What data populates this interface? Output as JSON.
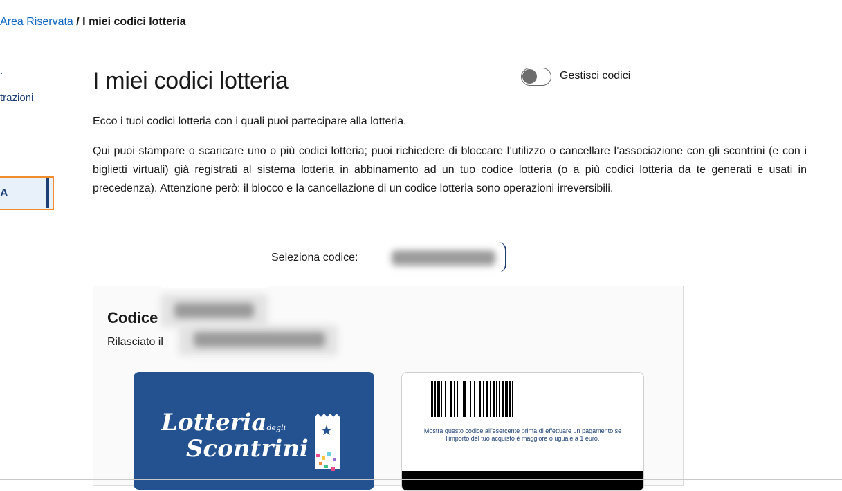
{
  "breadcrumb": {
    "link": "Area Riservata",
    "separator": " / ",
    "current": "I miei codici lotteria"
  },
  "sidebar": {
    "item_partial": "trazioni",
    "active_partial": "A"
  },
  "page": {
    "title": "I miei codici lotteria",
    "toggle_label": "Gestisci codici",
    "toggle_on": false,
    "intro": "Ecco i tuoi codici lotteria con i quali puoi partecipare alla lotteria.",
    "description": "Qui puoi stampare o scaricare uno o più codici lotteria; puoi richiedere di bloccare l’utilizzo o cancellare l’associazione con gli scontrini (e con i biglietti virtuali) già registrati al sistema lotteria in abbinamento ad un tuo codice lotteria (o a più codici lotteria da te generati e usati in precedenza). Attenzione però: il blocco e la cancellazione di un codice lotteria sono operazioni irreversibili."
  },
  "selector": {
    "label": "Seleziona codice:"
  },
  "card": {
    "title": "Codice",
    "issued_prefix": "Rilasciato il"
  },
  "logo": {
    "line1": "Lotteria",
    "small": "degli",
    "line2": "Scontrini"
  },
  "barcode_note": "Mostra questo codice all'esercente prima di effettuare un pagamento se l'importo del tuo acquisto è maggiore o uguale a 1 euro.",
  "colors": {
    "primary": "#245290",
    "link": "#0b66c3",
    "focus": "#f08c2b"
  }
}
